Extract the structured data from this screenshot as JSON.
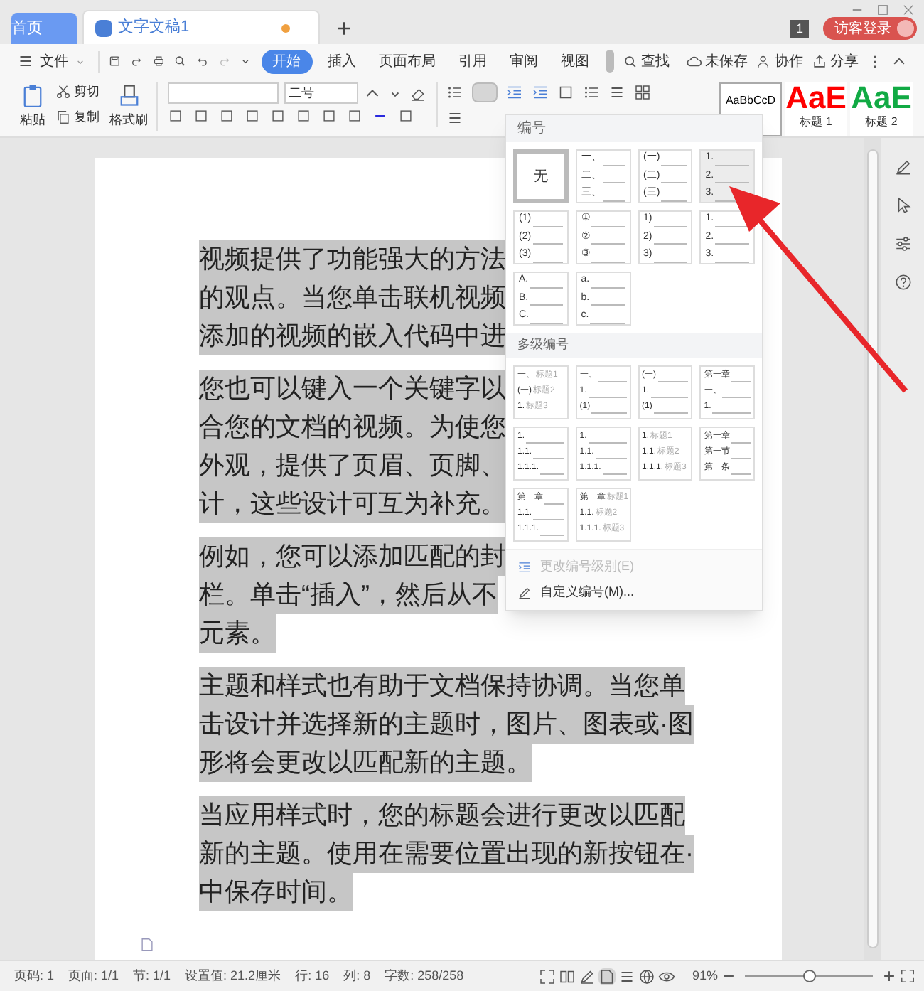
{
  "tabs": [
    {
      "label": "首页",
      "selected": false,
      "unsaved": false
    },
    {
      "label": "文字文稿1",
      "selected": true,
      "unsaved": true
    }
  ],
  "window_count": "1",
  "login": "访客登录",
  "menu": {
    "file": "文件",
    "tabs": [
      {
        "label": "开始",
        "selected": true
      },
      {
        "label": "插入",
        "selected": false
      },
      {
        "label": "页面布局",
        "selected": false
      },
      {
        "label": "引用",
        "selected": false
      },
      {
        "label": "审阅",
        "selected": false
      },
      {
        "label": "视图",
        "selected": false
      }
    ],
    "search": "查找",
    "unsaved": "未保存",
    "collab": "协作",
    "share": "分享"
  },
  "ribbon": {
    "paste": "粘贴",
    "cut": "剪切",
    "copy": "复制",
    "format_painter": "格式刷",
    "font_size": "二号",
    "styles": [
      {
        "sample": "AaBbCcD",
        "kind": "body"
      },
      {
        "sample": "AaE",
        "label": "标题 1",
        "kind": "h1"
      },
      {
        "sample": "AaE",
        "label": "标题 2",
        "kind": "h2"
      }
    ]
  },
  "numbering_menu": {
    "title": "编号",
    "single": [
      {
        "kind": "none",
        "label": "无",
        "selected": true,
        "hovered": false
      },
      {
        "kind": "list",
        "lines": [
          "一、",
          "二、",
          "三、"
        ],
        "selected": false,
        "hovered": false
      },
      {
        "kind": "list",
        "lines": [
          "(一)",
          "(二)",
          "(三)"
        ],
        "selected": false,
        "hovered": false
      },
      {
        "kind": "list",
        "lines": [
          "1.",
          "2.",
          "3."
        ],
        "selected": false,
        "hovered": true
      },
      {
        "kind": "list",
        "lines": [
          "(1)",
          "(2)",
          "(3)"
        ],
        "selected": false,
        "hovered": false
      },
      {
        "kind": "list",
        "lines": [
          "①",
          "②",
          "③"
        ],
        "selected": false,
        "hovered": false
      },
      {
        "kind": "list",
        "lines": [
          "1)",
          "2)",
          "3)"
        ],
        "selected": false,
        "hovered": false
      },
      {
        "kind": "list",
        "lines": [
          "1.",
          "2.",
          "3."
        ],
        "selected": false,
        "hovered": false
      },
      {
        "kind": "list",
        "lines": [
          "A.",
          "B.",
          "C."
        ],
        "selected": false,
        "hovered": false
      },
      {
        "kind": "list",
        "lines": [
          "a.",
          "b.",
          "c."
        ],
        "selected": false,
        "hovered": false
      }
    ],
    "multi_title": "多级编号",
    "multi": [
      {
        "lines": [
          {
            "num": "一、",
            "heading": "标题1"
          },
          {
            "num": "(一)",
            "heading": "标题2"
          },
          {
            "num": "1.",
            "heading": "标题3"
          }
        ]
      },
      {
        "lines": [
          {
            "num": "一、"
          },
          {
            "num": "1."
          },
          {
            "num": "(1)"
          }
        ]
      },
      {
        "lines": [
          {
            "num": "(一)"
          },
          {
            "num": "1."
          },
          {
            "num": "(1)"
          }
        ]
      },
      {
        "lines": [
          {
            "num": "第一章"
          },
          {
            "num": "一、"
          },
          {
            "num": "1."
          }
        ]
      },
      {
        "lines": [
          {
            "num": "1."
          },
          {
            "num": "1.1."
          },
          {
            "num": "1.1.1."
          }
        ]
      },
      {
        "lines": [
          {
            "num": "1."
          },
          {
            "num": "1.1."
          },
          {
            "num": "1.1.1."
          }
        ]
      },
      {
        "lines": [
          {
            "num": "1.",
            "heading": "标题1"
          },
          {
            "num": "1.1.",
            "heading": "标题2"
          },
          {
            "num": "1.1.1.",
            "heading": "标题3"
          }
        ]
      },
      {
        "lines": [
          {
            "num": "第一章"
          },
          {
            "num": "第一节"
          },
          {
            "num": "第一条"
          }
        ]
      },
      {
        "lines": [
          {
            "num": "第一章"
          },
          {
            "num": "1.1."
          },
          {
            "num": "1.1.1."
          }
        ]
      },
      {
        "lines": [
          {
            "num": "第一章",
            "heading": "标题1"
          },
          {
            "num": "1.1.",
            "heading": "标题2"
          },
          {
            "num": "1.1.1.",
            "heading": "标题3"
          }
        ]
      }
    ],
    "actions": [
      {
        "label": "更改编号级别(E)",
        "disabled": true,
        "kind": "level"
      },
      {
        "label": "自定义编号(M)...",
        "disabled": false,
        "kind": "custom"
      }
    ]
  },
  "document": {
    "paragraphs": [
      {
        "selected": true,
        "lines": [
          "视频提供了功能强大的方法",
          "的观点。当您单击联机视频",
          "添加的视频的嵌入代码中进"
        ]
      },
      {
        "selected": true,
        "lines": [
          "您也可以键入一个关键字以",
          "合您的文档的视频。为使您",
          "外观，提供了页眉、页脚、",
          "计，这些设计可互为补充。"
        ]
      },
      {
        "selected": true,
        "lines": [
          "例如，您可以添加匹配的封",
          "栏。单击“插入”，然后从不",
          "元素。"
        ]
      },
      {
        "selected": true,
        "lines": [
          "主题和样式也有助于文档保持协调。当您单",
          "击设计并选择新的主题时，图片、图表或·图",
          "形将会更改以匹配新的主题。"
        ]
      },
      {
        "selected": true,
        "lines": [
          "当应用样式时，您的标题会进行更改以匹配",
          "新的主题。使用在需要位置出现的新按钮在·",
          "中保存时间。"
        ]
      }
    ]
  },
  "status_bar": {
    "items": [
      "页码: 1",
      "页面: 1/1",
      "节: 1/1",
      "设置值: 21.2厘米",
      "行: 16",
      "列: 8",
      "字数: 258/258"
    ],
    "zoom": "91%",
    "level": 0.45
  }
}
